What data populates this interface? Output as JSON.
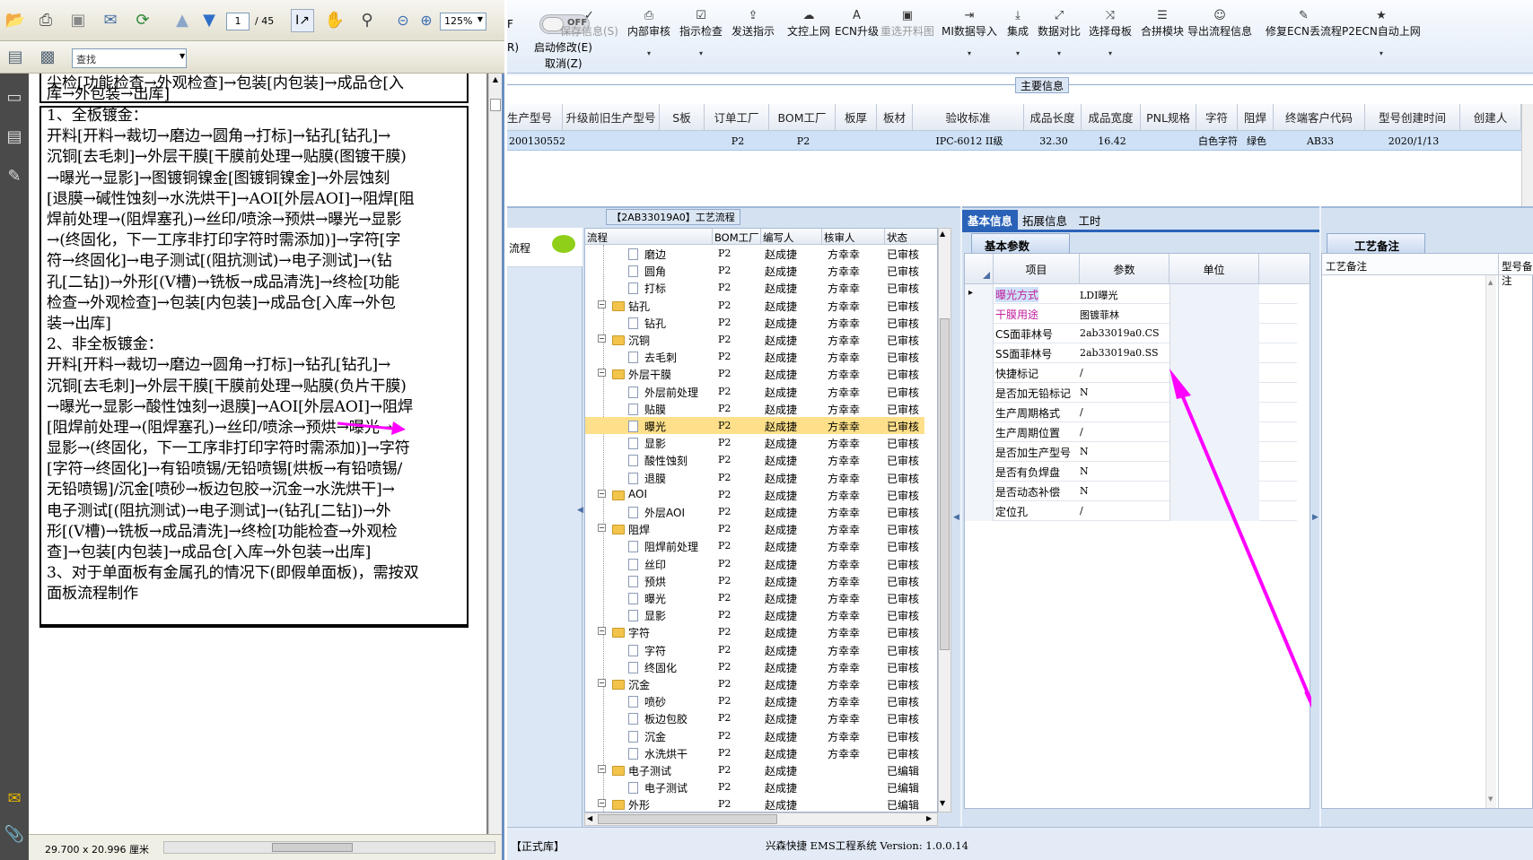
{
  "pdf": {
    "page_current": "1",
    "page_total": "/ 45",
    "zoom": "125%",
    "find_placeholder": "查找",
    "page_size": "29.700 x 20.996 厘米",
    "doc_lines": [
      "尖检[功能检查→外观检查]→包装[内包装]→成品仓[入",
      "库→外包装→出库]",
      "1、全板镀金：",
      "开料[开料→裁切→磨边→圆角→打标]→钻孔[钻孔]→",
      "沉铜[去毛刺]→外层干膜[干膜前处理→贴膜(图镀干膜)",
      "→曝光→显影]→图镀铜镍金[图镀铜镍金]→外层蚀刻",
      "[退膜→碱性蚀刻→水洗烘干]→AOI[外层AOI]→阻焊[阻",
      "焊前处理→(阻焊塞孔)→丝印/喷涂→预烘→曝光→显影",
      "→(终固化，下一工序非打印字符时需添加)]→字符[字",
      "符→终固化]→电子测试[(阻抗测试)→电子测试]→(钻",
      "孔[二钻])→外形[(V槽)→铣板→成品清洗]→终检[功能",
      "检查→外观检查]→包装[内包装]→成品仓[入库→外包",
      "装→出库]",
      "2、非全板镀金：",
      "开料[开料→裁切→磨边→圆角→打标]→钻孔[钻孔]→",
      "沉铜[去毛刺]→外层干膜[干膜前处理→贴膜(负片干膜)",
      "→曝光→显影→酸性蚀刻→退膜]→AOI[外层AOI]→阻焊",
      "[阻焊前处理→(阻焊塞孔)→丝印/喷涂→预烘→曝光→",
      "显影→(终固化，下一工序非打印字符时需添加)]→字符",
      "[字符→终固化]→有铅喷锡/无铅喷锡[烘板→有铅喷锡/",
      "无铅喷锡]/沉金[喷砂→板边包胶→沉金→水洗烘干]→",
      "电子测试[(阻抗测试)→电子测试]→(钻孔[二钻])→外",
      "形[(V槽)→铣板→成品清洗]→终检[功能检查→外观检",
      "查]→包装[内包装]→成品仓[入库→外包装→出库]",
      "3、对于单面板有金属孔的情况下(即假单面板)，需按双",
      "面板流程制作"
    ]
  },
  "app": {
    "toolbar": {
      "toggle_label": "OFF",
      "left_cut": "F",
      "left_cut2": "R)",
      "start_edit": "启动修改(E)",
      "cancel": "取消(Z)",
      "buttons": [
        {
          "label": "保存信息(S)",
          "icon": "check-icon",
          "disabled": true
        },
        {
          "label": "内部审核",
          "icon": "printer-icon",
          "disabled": false
        },
        {
          "label": "指示检查",
          "icon": "checkbox-icon",
          "disabled": false
        },
        {
          "label": "发送指示",
          "icon": "upload-icon",
          "disabled": false
        },
        {
          "label": "文控上网",
          "icon": "cloud-icon",
          "disabled": false
        },
        {
          "label": "ECN升级",
          "icon": "ecn-icon",
          "disabled": false
        },
        {
          "label": "重选开料图",
          "icon": "image-icon",
          "disabled": true
        },
        {
          "label": "MI数据导入",
          "icon": "import-icon",
          "disabled": false
        },
        {
          "label": "集成",
          "icon": "download-icon",
          "disabled": false
        },
        {
          "label": "数据对比",
          "icon": "compare-icon",
          "disabled": false
        },
        {
          "label": "选择母板",
          "icon": "shuffle-icon",
          "disabled": false
        },
        {
          "label": "合拼模块",
          "icon": "list-icon",
          "disabled": false
        },
        {
          "label": "导出流程信息",
          "icon": "smile-icon",
          "disabled": false
        },
        {
          "label": "修复ECN丢流程",
          "icon": "wrench-icon",
          "disabled": false
        },
        {
          "label": "P2ECN自动上网",
          "icon": "star-icon",
          "disabled": false
        }
      ]
    },
    "main_info": {
      "title": "主要信息",
      "columns": [
        "生产型号",
        "升级前旧生产型号",
        "S板",
        "订单工厂",
        "BOM工厂",
        "板厚",
        "板材",
        "验收标准",
        "成品长度",
        "成品宽度",
        "PNL规格",
        "字符",
        "阻焊",
        "终端客户代码",
        "型号创建时间",
        "创建人"
      ],
      "row": [
        "200130552",
        "",
        "",
        "P2",
        "P2",
        "",
        "",
        "IPC-6012 II级",
        "32.30",
        "16.42",
        "",
        "白色字符",
        "绿色",
        "AB33",
        "2020/1/13",
        ""
      ]
    },
    "process": {
      "title": "【2AB33019A0】工艺流程",
      "left_label": "流程",
      "columns": [
        "流程",
        "BOM工厂",
        "编写人",
        "核审人",
        "状态"
      ],
      "rows": [
        {
          "name": "磨边",
          "folder": false,
          "bom": "P2",
          "writer": "赵成捷",
          "reviewer": "方幸幸",
          "status": "已审核"
        },
        {
          "name": "圆角",
          "folder": false,
          "bom": "P2",
          "writer": "赵成捷",
          "reviewer": "方幸幸",
          "status": "已审核"
        },
        {
          "name": "打标",
          "folder": false,
          "bom": "P2",
          "writer": "赵成捷",
          "reviewer": "方幸幸",
          "status": "已审核"
        },
        {
          "name": "钻孔",
          "folder": true,
          "bom": "P2",
          "writer": "赵成捷",
          "reviewer": "方幸幸",
          "status": "已审核"
        },
        {
          "name": "钻孔",
          "folder": false,
          "bom": "P2",
          "writer": "赵成捷",
          "reviewer": "方幸幸",
          "status": "已审核"
        },
        {
          "name": "沉铜",
          "folder": true,
          "bom": "P2",
          "writer": "赵成捷",
          "reviewer": "方幸幸",
          "status": "已审核"
        },
        {
          "name": "去毛刺",
          "folder": false,
          "bom": "P2",
          "writer": "赵成捷",
          "reviewer": "方幸幸",
          "status": "已审核"
        },
        {
          "name": "外层干膜",
          "folder": true,
          "bom": "P2",
          "writer": "赵成捷",
          "reviewer": "方幸幸",
          "status": "已审核"
        },
        {
          "name": "外层前处理",
          "folder": false,
          "bom": "P2",
          "writer": "赵成捷",
          "reviewer": "方幸幸",
          "status": "已审核"
        },
        {
          "name": "贴膜",
          "folder": false,
          "bom": "P2",
          "writer": "赵成捷",
          "reviewer": "方幸幸",
          "status": "已审核"
        },
        {
          "name": "曝光",
          "folder": false,
          "bom": "P2",
          "writer": "赵成捷",
          "reviewer": "方幸幸",
          "status": "已审核",
          "selected": true
        },
        {
          "name": "显影",
          "folder": false,
          "bom": "P2",
          "writer": "赵成捷",
          "reviewer": "方幸幸",
          "status": "已审核"
        },
        {
          "name": "酸性蚀刻",
          "folder": false,
          "bom": "P2",
          "writer": "赵成捷",
          "reviewer": "方幸幸",
          "status": "已审核"
        },
        {
          "name": "退膜",
          "folder": false,
          "bom": "P2",
          "writer": "赵成捷",
          "reviewer": "方幸幸",
          "status": "已审核"
        },
        {
          "name": "AOI",
          "folder": true,
          "bom": "P2",
          "writer": "赵成捷",
          "reviewer": "方幸幸",
          "status": "已审核"
        },
        {
          "name": "外层AOI",
          "folder": false,
          "bom": "P2",
          "writer": "赵成捷",
          "reviewer": "方幸幸",
          "status": "已审核"
        },
        {
          "name": "阻焊",
          "folder": true,
          "bom": "P2",
          "writer": "赵成捷",
          "reviewer": "方幸幸",
          "status": "已审核"
        },
        {
          "name": "阻焊前处理",
          "folder": false,
          "bom": "P2",
          "writer": "赵成捷",
          "reviewer": "方幸幸",
          "status": "已审核"
        },
        {
          "name": "丝印",
          "folder": false,
          "bom": "P2",
          "writer": "赵成捷",
          "reviewer": "方幸幸",
          "status": "已审核"
        },
        {
          "name": "预烘",
          "folder": false,
          "bom": "P2",
          "writer": "赵成捷",
          "reviewer": "方幸幸",
          "status": "已审核"
        },
        {
          "name": "曝光",
          "folder": false,
          "bom": "P2",
          "writer": "赵成捷",
          "reviewer": "方幸幸",
          "status": "已审核"
        },
        {
          "name": "显影",
          "folder": false,
          "bom": "P2",
          "writer": "赵成捷",
          "reviewer": "方幸幸",
          "status": "已审核"
        },
        {
          "name": "字符",
          "folder": true,
          "bom": "P2",
          "writer": "赵成捷",
          "reviewer": "方幸幸",
          "status": "已审核"
        },
        {
          "name": "字符",
          "folder": false,
          "bom": "P2",
          "writer": "赵成捷",
          "reviewer": "方幸幸",
          "status": "已审核"
        },
        {
          "name": "终固化",
          "folder": false,
          "bom": "P2",
          "writer": "赵成捷",
          "reviewer": "方幸幸",
          "status": "已审核"
        },
        {
          "name": "沉金",
          "folder": true,
          "bom": "P2",
          "writer": "赵成捷",
          "reviewer": "方幸幸",
          "status": "已审核"
        },
        {
          "name": "喷砂",
          "folder": false,
          "bom": "P2",
          "writer": "赵成捷",
          "reviewer": "方幸幸",
          "status": "已审核"
        },
        {
          "name": "板边包胶",
          "folder": false,
          "bom": "P2",
          "writer": "赵成捷",
          "reviewer": "方幸幸",
          "status": "已审核"
        },
        {
          "name": "沉金",
          "folder": false,
          "bom": "P2",
          "writer": "赵成捷",
          "reviewer": "方幸幸",
          "status": "已审核"
        },
        {
          "name": "水洗烘干",
          "folder": false,
          "bom": "P2",
          "writer": "赵成捷",
          "reviewer": "方幸幸",
          "status": "已审核"
        },
        {
          "name": "电子测试",
          "folder": true,
          "bom": "P2",
          "writer": "赵成捷",
          "reviewer": "",
          "status": "已编辑"
        },
        {
          "name": "电子测试",
          "folder": false,
          "bom": "P2",
          "writer": "赵成捷",
          "reviewer": "",
          "status": "已编辑"
        },
        {
          "name": "外形",
          "folder": true,
          "bom": "P2",
          "writer": "赵成捷",
          "reviewer": "",
          "status": "已编辑"
        }
      ]
    },
    "tabs": [
      "基本信息",
      "拓展信息",
      "工时"
    ],
    "basic_params": {
      "title": "基本参数",
      "columns": [
        "项目",
        "参数",
        "单位"
      ],
      "rows": [
        {
          "item": "曝光方式",
          "value": "LDI曝光",
          "highlight": true
        },
        {
          "item": "干膜用途",
          "value": "图镀菲林",
          "highlight": true
        },
        {
          "item": "CS面菲林号",
          "value": "2ab33019a0.CS",
          "highlight": false
        },
        {
          "item": "SS面菲林号",
          "value": "2ab33019a0.SS",
          "highlight": false
        },
        {
          "item": "快捷标记",
          "value": "/",
          "highlight": false
        },
        {
          "item": "是否加无铅标记",
          "value": "N",
          "highlight": false
        },
        {
          "item": "生产周期格式",
          "value": "/",
          "highlight": false
        },
        {
          "item": "生产周期位置",
          "value": "/",
          "highlight": false
        },
        {
          "item": "是否加生产型号",
          "value": "N",
          "highlight": false
        },
        {
          "item": "是否有负焊盘",
          "value": "N",
          "highlight": false
        },
        {
          "item": "是否动态补偿",
          "value": "N",
          "highlight": false
        },
        {
          "item": "定位孔",
          "value": "/",
          "highlight": false
        }
      ]
    },
    "remarks": {
      "title": "工艺备注",
      "col1": "工艺备注",
      "col2": "型号备注"
    },
    "status": {
      "library": "【正式库】",
      "system": "兴森快捷 EMS工程系统 Version: 1.0.0.14"
    },
    "colors": {
      "annotation": "#ff00ff",
      "selected_row": "#ffe08a",
      "accent": "#2a62b8"
    }
  }
}
